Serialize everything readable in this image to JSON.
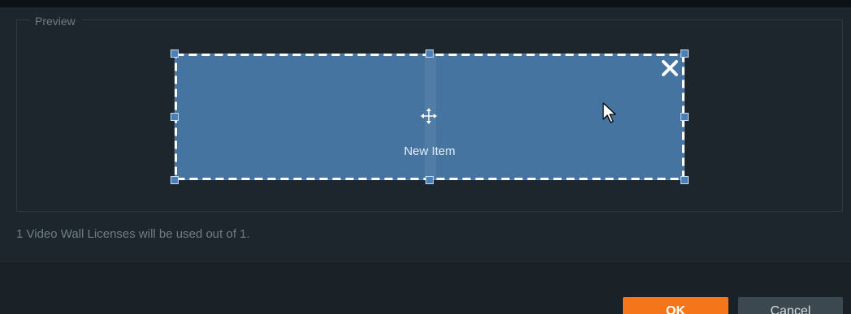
{
  "preview": {
    "group_title": "Preview",
    "item": {
      "label": "New Item",
      "fill_color": "#4674a0",
      "border_style": "dashed white",
      "icons": [
        "close-icon",
        "move-icon",
        "resize-handle"
      ]
    },
    "cursor": "arrow-cursor-icon"
  },
  "license_text": "1 Video Wall Licenses will be used out of 1.",
  "buttons": {
    "ok_label": "OK",
    "cancel_label": "Cancel"
  },
  "colors": {
    "background": "#1d262c",
    "accent": "#f5761a",
    "item": "#4674a0"
  }
}
